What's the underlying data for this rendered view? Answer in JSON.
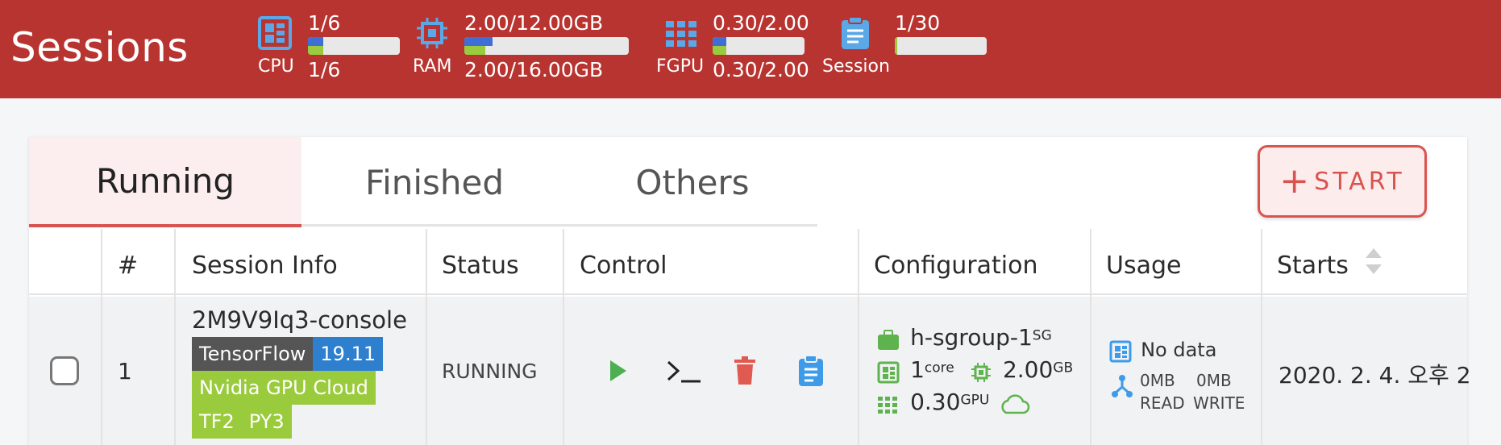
{
  "header": {
    "title": "Sessions",
    "resources": [
      {
        "label": "CPU",
        "value_top": "1/6",
        "value_bottom": "1/6",
        "fill_top": 0.17,
        "fill_bottom": 0.17,
        "icon": "cpu-icon"
      },
      {
        "label": "RAM",
        "value_top": "2.00/12.00GB",
        "value_bottom": "2.00/16.00GB",
        "fill_top": 0.17,
        "fill_bottom": 0.125,
        "icon": "ram-chip-icon"
      },
      {
        "label": "FGPU",
        "value_top": "0.30/2.00",
        "value_bottom": "0.30/2.00",
        "fill_top": 0.15,
        "fill_bottom": 0.15,
        "icon": "gpu-grid-icon"
      },
      {
        "label": "Session",
        "value_top": "1/30",
        "fill_bottom": 0.03,
        "icon": "clipboard-icon"
      }
    ]
  },
  "tabs": [
    {
      "label": "Running",
      "active": true
    },
    {
      "label": "Finished",
      "active": false
    },
    {
      "label": "Others",
      "active": false
    }
  ],
  "start_button": {
    "label": "START"
  },
  "table": {
    "columns": [
      "#",
      "Session Info",
      "Status",
      "Control",
      "Configuration",
      "Usage",
      "Starts"
    ],
    "rows": [
      {
        "index": "1",
        "session_name": "2M9V9Iq3-console",
        "tags": {
          "framework": "TensorFlow",
          "version": "19.11",
          "vendor": "Nvidia GPU Cloud",
          "tf": "TF2",
          "py": "PY3"
        },
        "status": "RUNNING",
        "config": {
          "group": "h-sgroup-1",
          "group_suffix": "SG",
          "cpu": "1",
          "cpu_unit": "core",
          "mem": "2.00",
          "mem_unit": "GB",
          "gpu": "0.30",
          "gpu_unit": "GPU"
        },
        "usage": {
          "text": "No data",
          "read_value": "0MB",
          "write_value": "0MB",
          "read_label": "READ",
          "write_label": "WRITE"
        },
        "starts": "2020. 2. 4. 오후 2"
      }
    ]
  },
  "colors": {
    "header_bg": "#b83430",
    "accent": "#d9534f",
    "blue": "#3f6fd6",
    "green": "#9acb3c",
    "tag_dark": "#555555",
    "tag_blue": "#2f7fcf",
    "tag_green": "#9acb3c"
  }
}
